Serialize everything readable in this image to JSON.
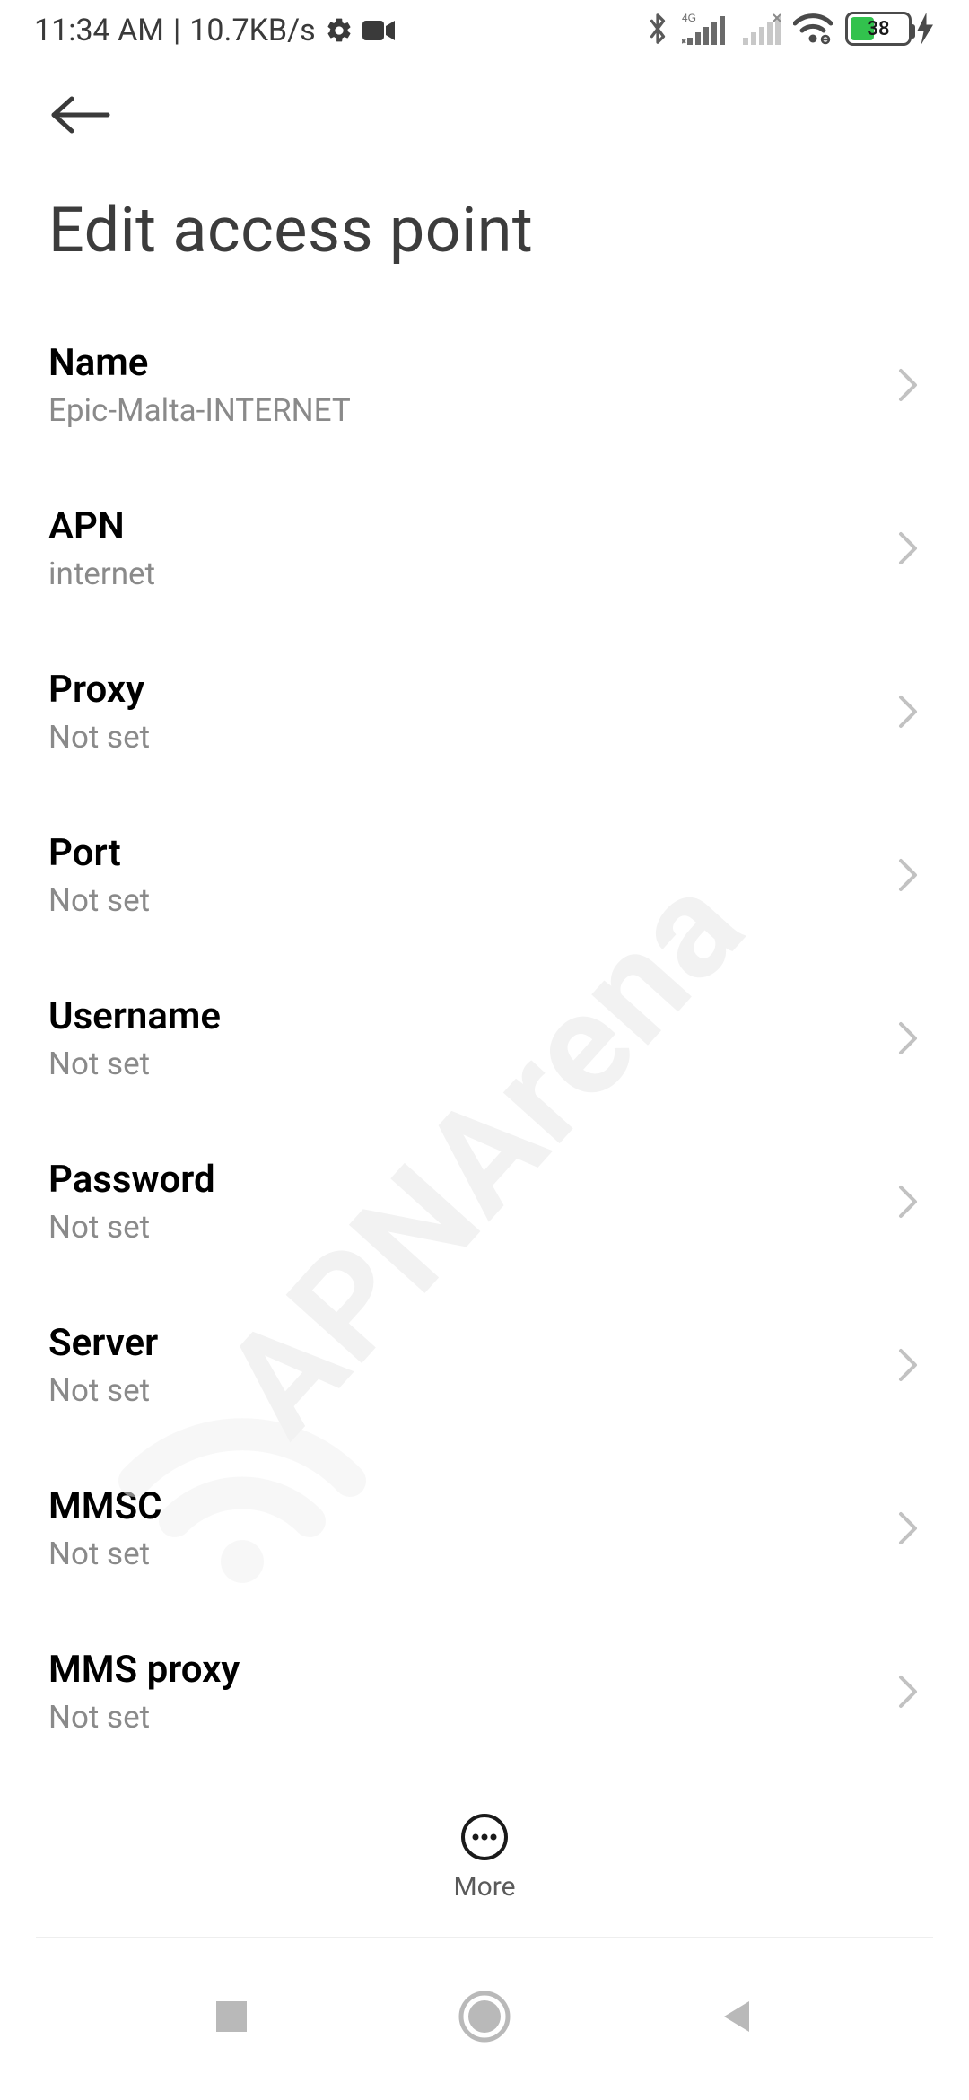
{
  "status": {
    "time": "11:34 AM",
    "sep": "|",
    "speed": "10.7KB/s",
    "battery_pct": "38"
  },
  "header": {
    "title": "Edit access point"
  },
  "fields": [
    {
      "label": "Name",
      "value": "Epic-Malta-INTERNET"
    },
    {
      "label": "APN",
      "value": "internet"
    },
    {
      "label": "Proxy",
      "value": "Not set"
    },
    {
      "label": "Port",
      "value": "Not set"
    },
    {
      "label": "Username",
      "value": "Not set"
    },
    {
      "label": "Password",
      "value": "Not set"
    },
    {
      "label": "Server",
      "value": "Not set"
    },
    {
      "label": "MMSC",
      "value": "Not set"
    },
    {
      "label": "MMS proxy",
      "value": "Not set"
    }
  ],
  "footer": {
    "more": "More"
  },
  "watermark": "APNArena"
}
